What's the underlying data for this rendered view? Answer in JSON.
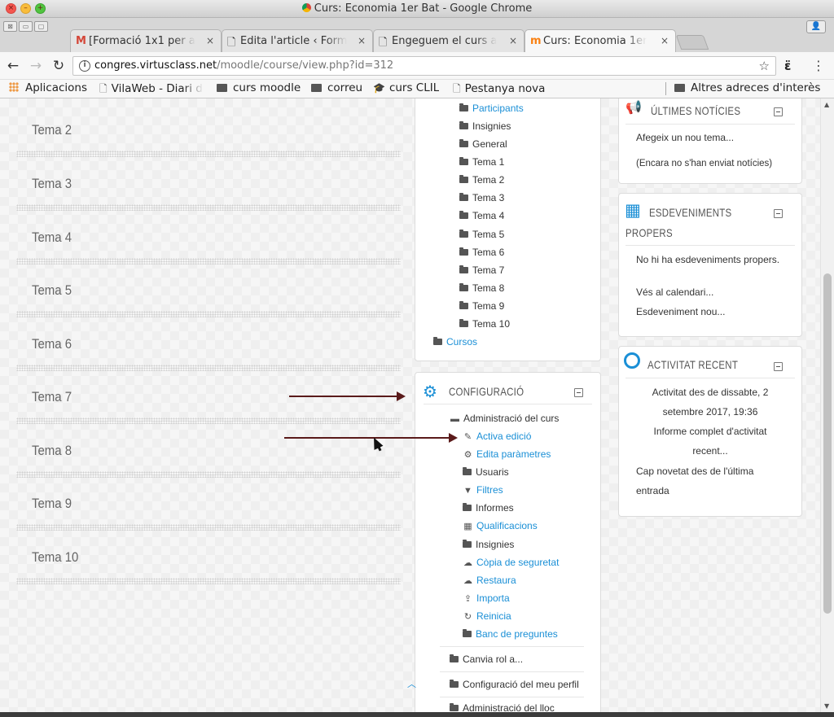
{
  "window": {
    "title": "Curs: Economia 1er Bat - Google Chrome"
  },
  "tabs": [
    {
      "icon": "M",
      "label": "[Formació 1x1 per a",
      "close": "×"
    },
    {
      "icon": "🗋",
      "label": "Edita l'article ‹ Form",
      "close": "×"
    },
    {
      "icon": "🗋",
      "label": "Engeguem el curs a",
      "close": "×"
    },
    {
      "icon": "m",
      "label": "Curs: Economia 1er",
      "close": "×"
    }
  ],
  "address": {
    "host": "congres.virtusclass.net",
    "path": "/moodle/course/view.php?id=312"
  },
  "bookmarks": {
    "apps": "Aplicacions",
    "items": [
      "VilaWeb - Diari d",
      "curs moodle",
      "correu",
      "curs CLIL",
      "Pestanya nova"
    ],
    "other": "Altres adreces d'interès"
  },
  "topics": [
    "Tema 2",
    "Tema 3",
    "Tema 4",
    "Tema 5",
    "Tema 6",
    "Tema 7",
    "Tema 8",
    "Tema 9",
    "Tema 10"
  ],
  "navigation": {
    "items": [
      "Participants",
      "Insignies",
      "General",
      "Tema 1",
      "Tema 2",
      "Tema 3",
      "Tema 4",
      "Tema 5",
      "Tema 6",
      "Tema 7",
      "Tema 8",
      "Tema 9",
      "Tema 10"
    ],
    "cursos": "Cursos"
  },
  "config": {
    "title": "CONFIGURACIÓ",
    "admin_course": "Administració del curs",
    "items": [
      {
        "icon": "pencil-icon",
        "glyph": "✎",
        "label": "Activa edició",
        "link": true
      },
      {
        "icon": "gears-icon",
        "glyph": "⚙",
        "label": "Edita paràmetres",
        "link": true
      },
      {
        "icon": "folder-icon",
        "glyph": "",
        "label": "Usuaris",
        "link": false
      },
      {
        "icon": "filter-icon",
        "glyph": "▼",
        "label": "Filtres",
        "link": true
      },
      {
        "icon": "folder-icon",
        "glyph": "",
        "label": "Informes",
        "link": false
      },
      {
        "icon": "table-icon",
        "glyph": "▦",
        "label": "Qualificacions",
        "link": true
      },
      {
        "icon": "folder-icon",
        "glyph": "",
        "label": "Insignies",
        "link": false
      },
      {
        "icon": "cloud-upload-icon",
        "glyph": "☁",
        "label": "Còpia de seguretat",
        "link": true
      },
      {
        "icon": "cloud-download-icon",
        "glyph": "☁",
        "label": "Restaura",
        "link": true
      },
      {
        "icon": "upload-icon",
        "glyph": "⇪",
        "label": "Importa",
        "link": true
      },
      {
        "icon": "refresh-icon",
        "glyph": "↻",
        "label": "Reinicia",
        "link": true
      },
      {
        "icon": "folder-icon",
        "glyph": "",
        "label": "Banc de preguntes",
        "link": true
      }
    ],
    "change_role": "Canvia rol a...",
    "profile_settings": "Configuració del meu perfil",
    "site_admin": "Administració del lloc"
  },
  "news": {
    "title": "ÚLTIMES NOTÍCIES",
    "add": "Afegeix un nou tema...",
    "empty": "(Encara no s'han enviat notícies)"
  },
  "events": {
    "title1": "ESDEVENIMENTS",
    "title2": "PROPERS",
    "empty": "No hi ha esdeveniments propers.",
    "calendar": "Vés al calendari...",
    "new_event": "Esdeveniment nou..."
  },
  "recent": {
    "title": "ACTIVITAT RECENT",
    "since_l1": "Activitat des de dissabte, 2",
    "since_l2": "setembre 2017, 19:36",
    "report_l1": "Informe complet d'activitat",
    "report_l2": "recent...",
    "none_l1": "Cap novetat des de l'última",
    "none_l2": "entrada"
  },
  "colors": {
    "link": "#1a8fd6",
    "arrow": "#5a1a1a"
  }
}
